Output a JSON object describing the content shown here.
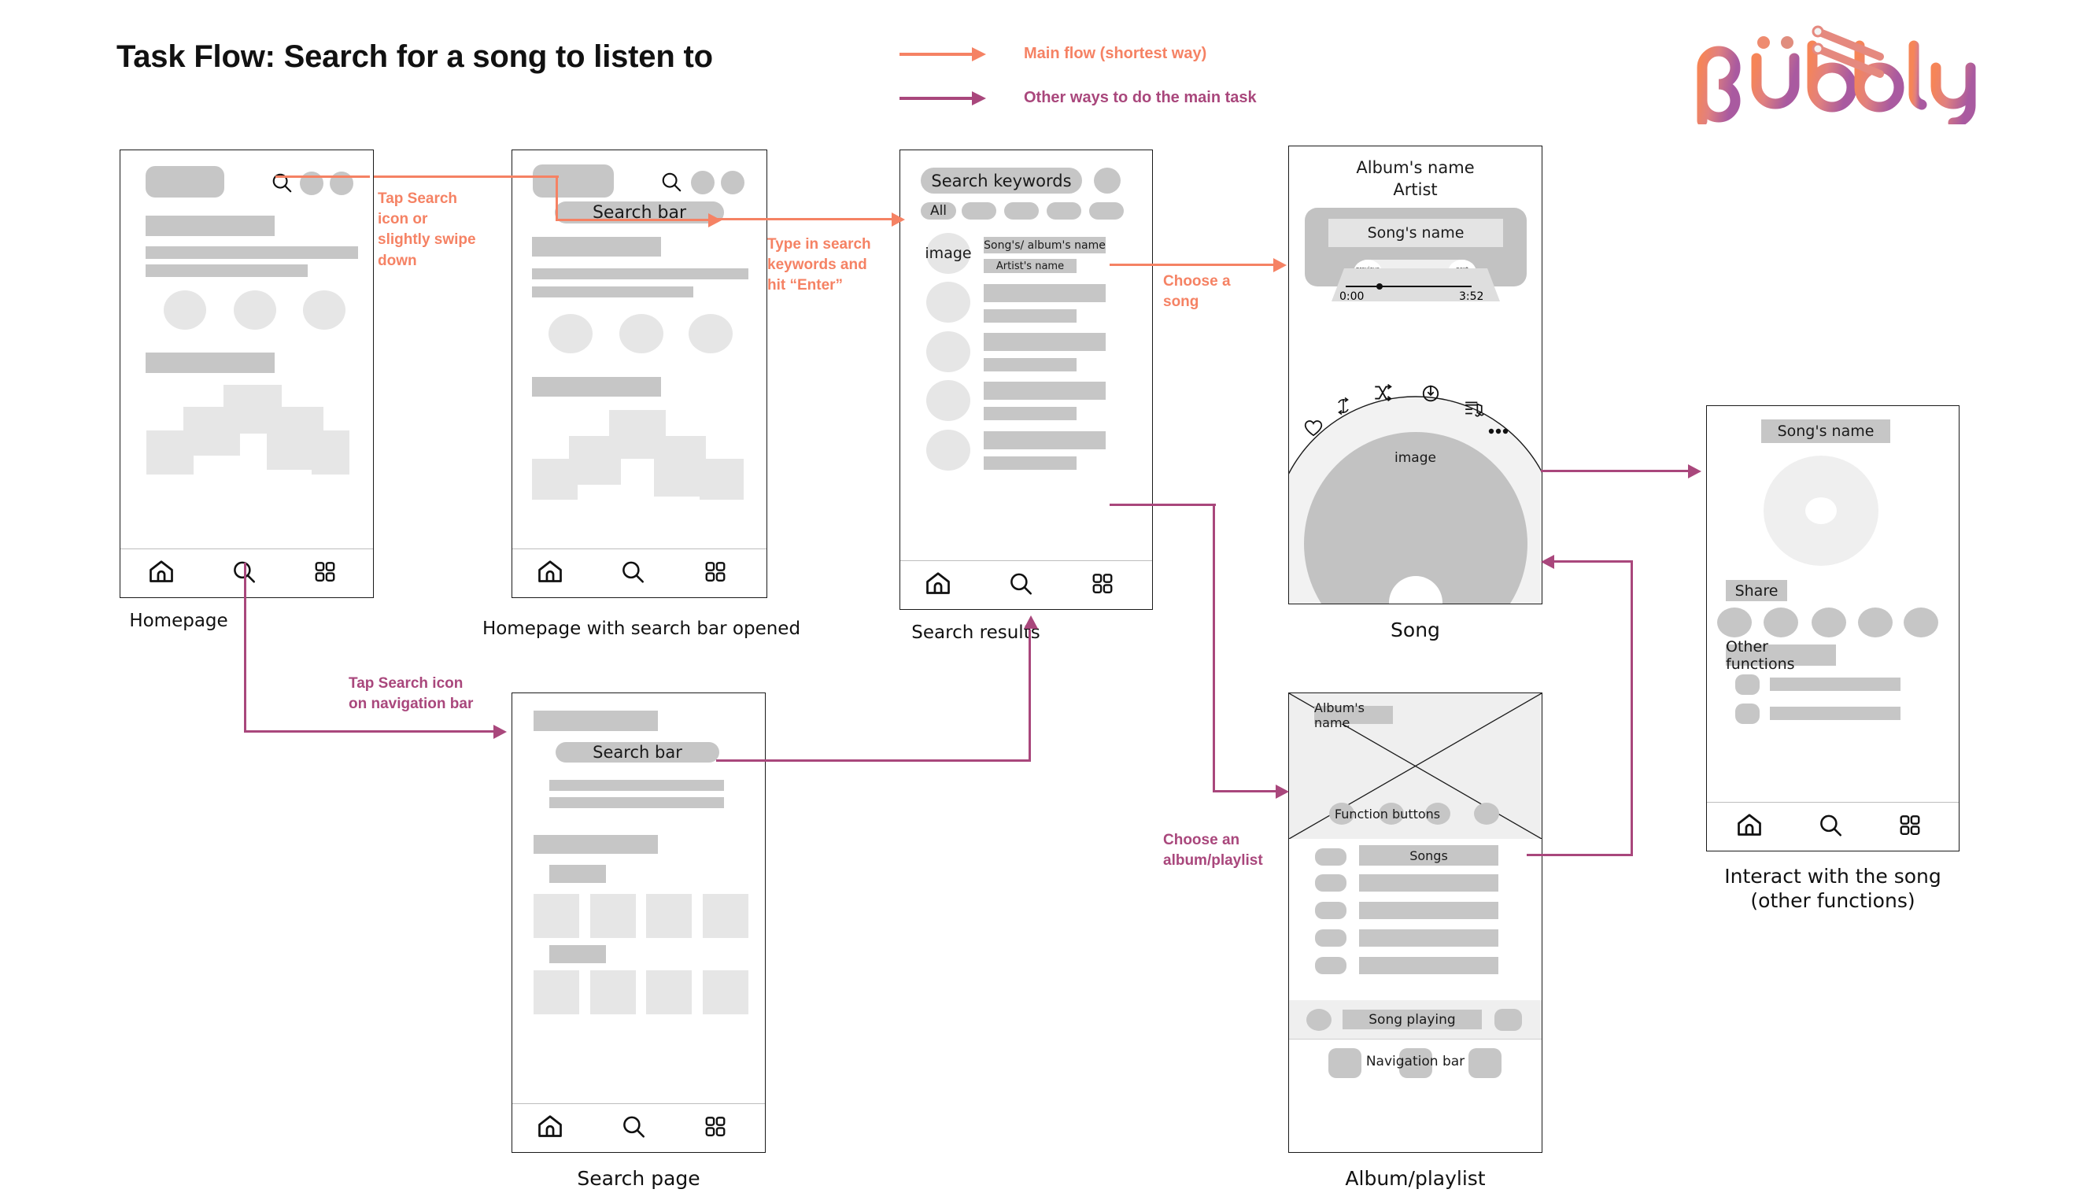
{
  "page": {
    "title": "Task Flow: Search for a song to listen to",
    "colors": {
      "main_flow": "#f58264",
      "other_flow": "#a9477c",
      "wire_mid": "#c6c6c6",
      "wire_light": "#e6e6e6"
    }
  },
  "legend": {
    "items": [
      {
        "label": "Main flow (shortest way)",
        "color": "#f58264",
        "name": "main-flow"
      },
      {
        "label": "Other ways to do the main task",
        "color": "#a9477c",
        "name": "other-flow"
      }
    ]
  },
  "logo": {
    "text": "bubbly",
    "icon": "music-note-beam-icon"
  },
  "screens": {
    "homepage": {
      "caption": "Homepage",
      "nav": [
        "home-icon",
        "search-icon",
        "grid-icon"
      ]
    },
    "homepage_search_open": {
      "caption": "Homepage with search bar opened",
      "search_bar_label": "Search bar",
      "nav": [
        "home-icon",
        "search-icon",
        "grid-icon"
      ]
    },
    "search_results": {
      "caption": "Search results",
      "search_field_label": "Search keywords",
      "filter_all_label": "All",
      "first_result": {
        "thumb_label": "image",
        "title": "Song's/ album's name",
        "subtitle": "Artist's name"
      },
      "nav": [
        "home-icon",
        "search-icon",
        "grid-icon"
      ]
    },
    "song": {
      "caption": "Song",
      "album_name": "Album's name",
      "artist": "Artist",
      "song_name": "Song's name",
      "previous_label": "previous\nsong",
      "pause_label": "pause",
      "next_label": "next\nsong",
      "time_current": "0:00",
      "time_total": "3:52",
      "image_label": "image",
      "dial_icons": [
        "heart-icon",
        "repeat-icon",
        "shuffle-icon",
        "download-icon",
        "queue-music-icon",
        "more-options-icon"
      ]
    },
    "album_playlist": {
      "caption": "Album/playlist",
      "album_name": "Album's name",
      "function_buttons_label": "Function buttons",
      "songs_label": "Songs",
      "song_playing_label": "Song playing",
      "navigation_bar_label": "Navigation bar"
    },
    "search_page": {
      "caption": "Search page",
      "search_bar_label": "Search bar",
      "nav": [
        "home-icon",
        "search-icon",
        "grid-icon"
      ]
    },
    "interact": {
      "caption": "Interact with the song\n(other functions)",
      "song_name": "Song's name",
      "share_label": "Share",
      "other_functions_label": "Other functions",
      "nav": [
        "home-icon",
        "search-icon",
        "grid-icon"
      ]
    }
  },
  "annotations": {
    "tap_search_icon": "Tap Search\nicon or\nslightly swipe\ndown",
    "type_keywords": "Type in search\nkeywords and\nhit “Enter”",
    "choose_song": "Choose a\nsong",
    "tap_search_nav": "Tap Search icon\non navigation bar",
    "choose_album": "Choose an\nalbum/playlist"
  }
}
